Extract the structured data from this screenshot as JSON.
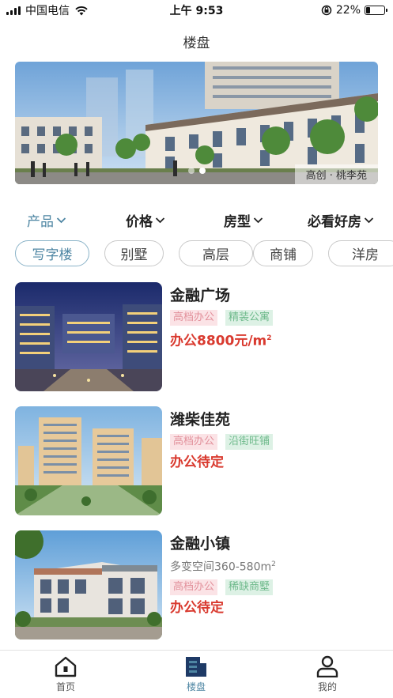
{
  "status_bar": {
    "carrier": "中国电信",
    "time": "上午 9:53",
    "battery": "22%",
    "battery_level": 0.22,
    "icons": [
      "signal-icon",
      "wifi-icon",
      "orientation-lock-icon",
      "battery-icon"
    ]
  },
  "nav": {
    "title": "楼盘"
  },
  "banner": {
    "caption": "高创 · 桃李苑",
    "slide_count": 2,
    "active_slide": 2
  },
  "filters": [
    {
      "label": "产品",
      "active": true
    },
    {
      "label": "价格",
      "active": false
    },
    {
      "label": "房型",
      "active": false
    },
    {
      "label": "必看好房",
      "active": false
    }
  ],
  "chips": [
    {
      "label": "写字楼",
      "active": true
    },
    {
      "label": "别墅",
      "active": false
    },
    {
      "label": "高层",
      "active": false
    },
    {
      "label": "商铺",
      "active": false
    },
    {
      "label": "洋房",
      "active": false
    }
  ],
  "listings": [
    {
      "name": "金融广场",
      "subtitle": "",
      "tags": [
        "高档办公",
        "精装公寓"
      ],
      "price": "办公8800元/m",
      "price_sup": "2"
    },
    {
      "name": "潍柴佳苑",
      "subtitle": "",
      "tags": [
        "高档办公",
        "沿街旺铺"
      ],
      "price": "办公待定",
      "price_sup": ""
    },
    {
      "name": "金融小镇",
      "subtitle": "多变空间360-580m",
      "subtitle_sup": "2",
      "tags": [
        "高档办公",
        "稀缺商墅"
      ],
      "price": "办公待定",
      "price_sup": ""
    }
  ],
  "tab_bar": [
    {
      "label": "首页",
      "icon": "home-icon",
      "active": false
    },
    {
      "label": "楼盘",
      "icon": "buildings-icon",
      "active": true
    },
    {
      "label": "我的",
      "icon": "user-icon",
      "active": false
    }
  ],
  "colors": {
    "accent": "#4e86a3",
    "price": "#d93a2f",
    "tag_pink_bg": "#fbe3e6",
    "tag_pink_text": "#e2909b",
    "tag_green_bg": "#ddf1e5",
    "tag_green_text": "#6fba8c"
  }
}
